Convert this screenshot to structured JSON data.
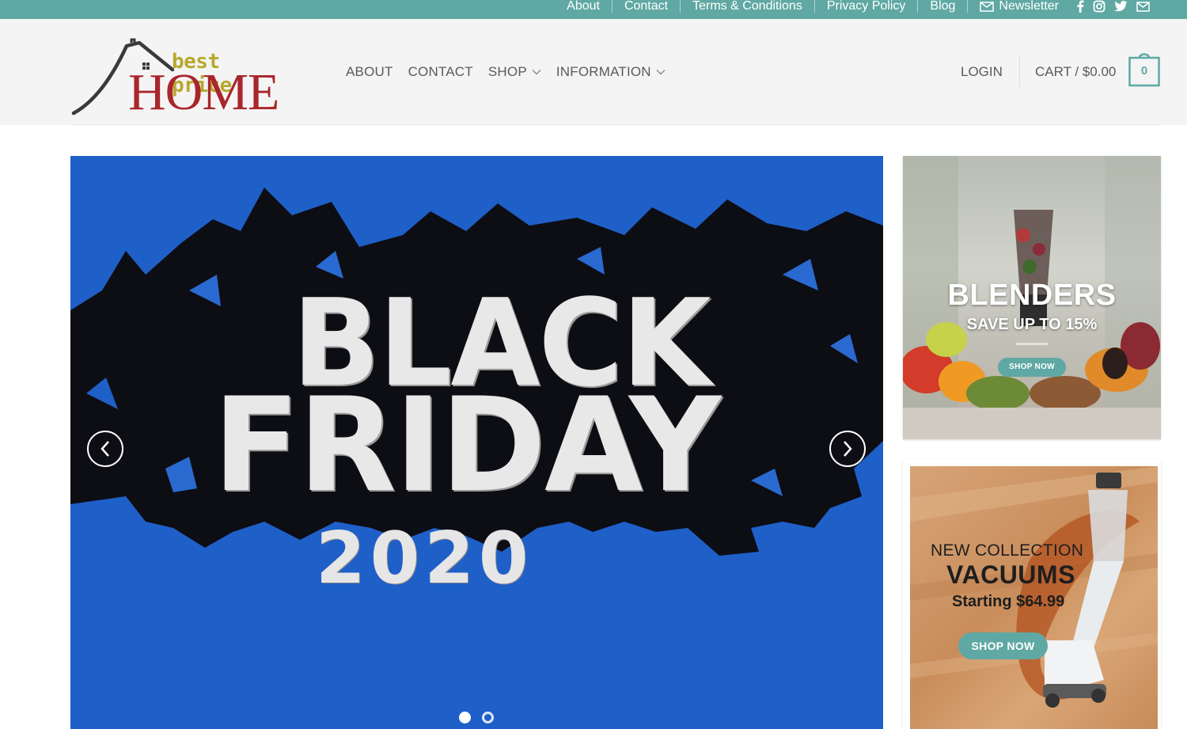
{
  "topbar": {
    "links": [
      "About",
      "Contact",
      "Terms & Conditions",
      "Privacy Policy",
      "Blog"
    ],
    "newsletter_label": "Newsletter",
    "social_icons": [
      "facebook-icon",
      "instagram-icon",
      "twitter-icon",
      "email-icon"
    ],
    "background": "#5fa8a3"
  },
  "logo": {
    "line1": "best price",
    "line2": "HOME"
  },
  "nav": {
    "items": [
      {
        "label": "ABOUT",
        "dropdown": false
      },
      {
        "label": "CONTACT",
        "dropdown": false
      },
      {
        "label": "SHOP",
        "dropdown": true
      },
      {
        "label": "INFORMATION",
        "dropdown": true
      }
    ]
  },
  "account": {
    "login_label": "LOGIN",
    "cart_label": "CART / $0.00",
    "cart_count": "0"
  },
  "hero": {
    "line1": "BLACK",
    "line2": "FRIDAY",
    "line3": "2020",
    "slides_total": 2,
    "active_slide": 1,
    "background": "#1f5fc8"
  },
  "promos": {
    "blenders": {
      "title": "BLENDERS",
      "subtitle": "SAVE UP TO 15%",
      "button": "SHOP NOW"
    },
    "vacuums": {
      "kicker": "NEW COLLECTION",
      "title": "VACUUMS",
      "price": "Starting $64.99",
      "button": "SHOP NOW"
    }
  },
  "colors": {
    "accent": "#5fa8a3",
    "logo_red": "#a9262c",
    "logo_gold": "#b7a82c"
  }
}
